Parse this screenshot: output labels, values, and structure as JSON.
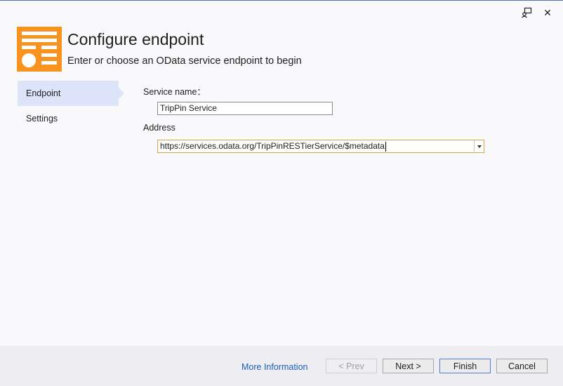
{
  "window": {
    "feedback_icon": "feedback-icon",
    "close_icon": "close-icon",
    "close_glyph": "✕"
  },
  "header": {
    "title": "Configure endpoint",
    "subtitle": "Enter or choose an OData service endpoint to begin",
    "logo_color": "#f7931e"
  },
  "nav": {
    "items": [
      {
        "label": "Endpoint",
        "active": true
      },
      {
        "label": "Settings",
        "active": false
      }
    ]
  },
  "form": {
    "service_name_label": "Service name：",
    "service_name_value": "TripPin Service",
    "address_label": "Address",
    "address_value": "https://services.odata.org/TripPinRESTierService/$metadata"
  },
  "footer": {
    "more_info": "More Information",
    "prev": "< Prev",
    "next": "Next >",
    "finish": "Finish",
    "cancel": "Cancel"
  }
}
